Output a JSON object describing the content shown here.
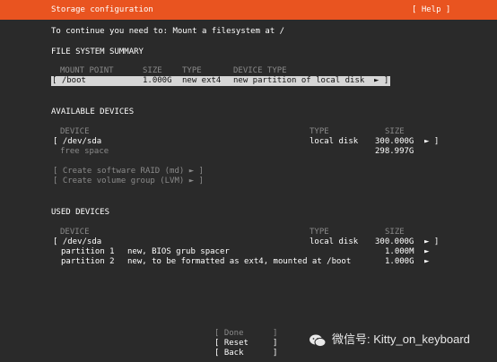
{
  "header": {
    "title": "Storage configuration",
    "help": "[ Help ]"
  },
  "intro": "To continue you need to: Mount a filesystem at /",
  "fs_summary": {
    "heading": "FILE SYSTEM SUMMARY",
    "columns": {
      "mount_point": "MOUNT POINT",
      "size": "SIZE",
      "type": "TYPE",
      "device_type": "DEVICE TYPE"
    },
    "row": {
      "mount_point": "[ /boot",
      "size": "1.000G",
      "type": "new ext4",
      "device_type": "new partition of local disk",
      "arrow": "► ]"
    }
  },
  "available": {
    "heading": "AVAILABLE DEVICES",
    "columns": {
      "device": "DEVICE",
      "type": "TYPE",
      "size": "SIZE"
    },
    "device": {
      "name": "[ /dev/sda",
      "type": "local disk",
      "size": "300.000G",
      "arrow": "► ]"
    },
    "free": {
      "label": "free space",
      "size": "298.997G"
    },
    "actions": [
      "[ Create software RAID (md) ► ]",
      "[ Create volume group (LVM) ► ]"
    ]
  },
  "used": {
    "heading": "USED DEVICES",
    "columns": {
      "device": "DEVICE",
      "type": "TYPE",
      "size": "SIZE"
    },
    "device": {
      "name": "[ /dev/sda",
      "type": "local disk",
      "size": "300.000G",
      "arrow": "► ]"
    },
    "partitions": [
      {
        "name": "partition 1",
        "desc": "new, BIOS grub spacer",
        "size": "1.000M",
        "arrow": "►"
      },
      {
        "name": "partition 2",
        "desc": "new, to be formatted as ext4, mounted at /boot",
        "size": "1.000G",
        "arrow": "►"
      }
    ]
  },
  "buttons": {
    "done": "[ Done      ]",
    "reset": "[ Reset     ]",
    "back": "[ Back      ]"
  },
  "watermark": {
    "text": "微信号: Kitty_on_keyboard"
  },
  "colors": {
    "accent": "#e95420",
    "background": "#2a2a2a",
    "selection": "#d6d6d6"
  }
}
